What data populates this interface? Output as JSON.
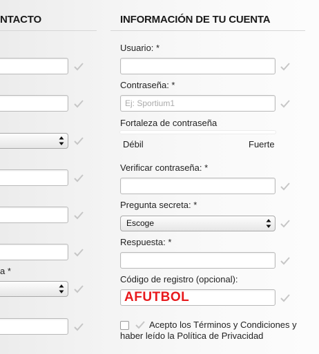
{
  "left_column": {
    "title": "NTACTO",
    "partial_label": "a *"
  },
  "right_column": {
    "title": "INFORMACIÓN DE TU CUENTA",
    "username": {
      "label": "Usuario: *",
      "value": ""
    },
    "password": {
      "label": "Contraseña: *",
      "placeholder": "Ej: Sportium1",
      "value": ""
    },
    "strength": {
      "label": "Fortaleza de contraseña",
      "low": "Débil",
      "high": "Fuerte"
    },
    "verify_password": {
      "label": "Verificar contraseña: *",
      "value": ""
    },
    "secret_question": {
      "label": "Pregunta secreta: *",
      "selected": "Escoge"
    },
    "answer": {
      "label": "Respuesta: *",
      "value": ""
    },
    "registration_code": {
      "label": "Código de registro (opcional):",
      "value": "AFUTBOL"
    },
    "terms": {
      "text": "Acepto los Términos y Condiciones y haber leído la Política de Privacidad"
    }
  },
  "colors": {
    "code_text": "#e8191c",
    "check_mark": "#c6c6c6"
  },
  "icons": {
    "valid_check": "check-icon",
    "select_arrows": "updown-arrows-icon"
  }
}
